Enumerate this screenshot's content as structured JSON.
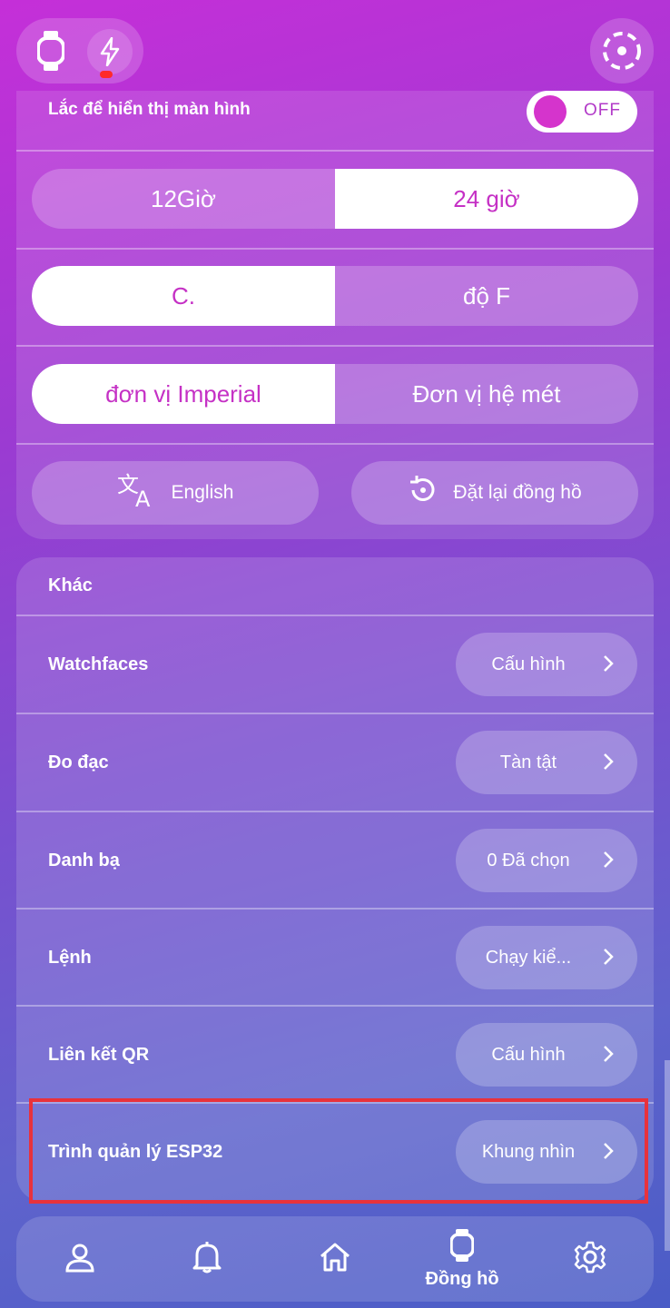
{
  "header": {
    "watch_icon": "watch-icon",
    "bolt_icon": "bolt-icon",
    "settings_icon": "dashed-circle-icon"
  },
  "display": {
    "shake_label": "Lắc để hiển thị màn hình",
    "shake_toggle": "OFF",
    "time_format": {
      "opt_12": "12Giờ",
      "opt_24": "24 giờ",
      "selected": "24 giờ"
    },
    "temperature": {
      "opt_c": "C.",
      "opt_f": "độ F",
      "selected": "C."
    },
    "units": {
      "imperial": "đơn vị Imperial",
      "metric": "Đơn vị hệ mét",
      "selected": "đơn vị Imperial"
    },
    "language_button": "English",
    "reset_button": "Đặt lại đồng hồ"
  },
  "other": {
    "title": "Khác",
    "rows": [
      {
        "label": "Watchfaces",
        "action": "Cấu hình"
      },
      {
        "label": "Đo đạc",
        "action": "Tàn tật"
      },
      {
        "label": "Danh bạ",
        "action": "0 Đã chọn"
      },
      {
        "label": "Lệnh",
        "action": "Chạy kiể..."
      },
      {
        "label": "Liên kết QR",
        "action": "Cấu hình"
      },
      {
        "label": "Trình quản lý ESP32",
        "action": "Khung nhìn"
      }
    ]
  },
  "nav": {
    "items": [
      {
        "icon": "person-icon",
        "label": ""
      },
      {
        "icon": "bell-icon",
        "label": ""
      },
      {
        "icon": "home-icon",
        "label": ""
      },
      {
        "icon": "watch-icon",
        "label": "Đồng hồ"
      },
      {
        "icon": "gear-icon",
        "label": ""
      }
    ]
  },
  "colors": {
    "accent": "#c531c5",
    "highlight": "#e8323c"
  }
}
